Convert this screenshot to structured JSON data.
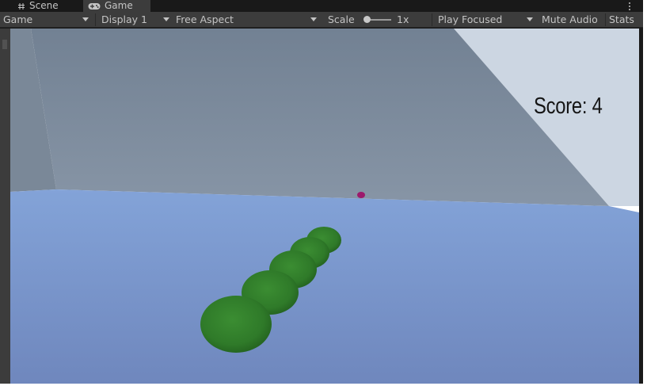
{
  "tabs": [
    {
      "label": "Scene",
      "icon": "hash-icon",
      "active": false
    },
    {
      "label": "Game",
      "icon": "gamepad-icon",
      "active": true
    }
  ],
  "toolbar": {
    "view_mode": "Game",
    "display": "Display 1",
    "aspect": "Free Aspect",
    "scale_label": "Scale",
    "scale_value": "1x",
    "play_mode": "Play Focused",
    "mute_audio": "Mute Audio",
    "stats": "Stats"
  },
  "game": {
    "score_text": "Score: 4"
  },
  "colors": {
    "editor_dark": "#191919",
    "toolbar": "#3c3c3c",
    "wall": "#7c8b9c",
    "floor": "#7d9acf",
    "snake": "#2d7a28",
    "food": "#9c1a6c"
  }
}
